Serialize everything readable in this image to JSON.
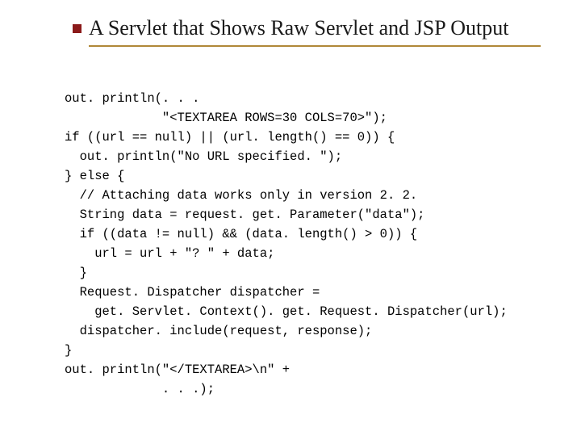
{
  "title": "A Servlet that Shows Raw Servlet and JSP Output",
  "code": {
    "l1": "out. println(. . .",
    "l2": "             \"<TEXTAREA ROWS=30 COLS=70>\");",
    "l3": "if ((url == null) || (url. length() == 0)) {",
    "l4": "  out. println(\"No URL specified. \");",
    "l5": "} else {",
    "l6": "  // Attaching data works only in version 2. 2.",
    "l7": "  String data = request. get. Parameter(\"data\");",
    "l8": "  if ((data != null) && (data. length() > 0)) {",
    "l9": "    url = url + \"? \" + data;",
    "l10": "  }",
    "l11": "  Request. Dispatcher dispatcher =",
    "l12": "    get. Servlet. Context(). get. Request. Dispatcher(url);",
    "l13": "  dispatcher. include(request, response);",
    "l14": "}",
    "l15": "out. println(\"</TEXTAREA>\\n\" +",
    "l16": "             . . .);"
  }
}
